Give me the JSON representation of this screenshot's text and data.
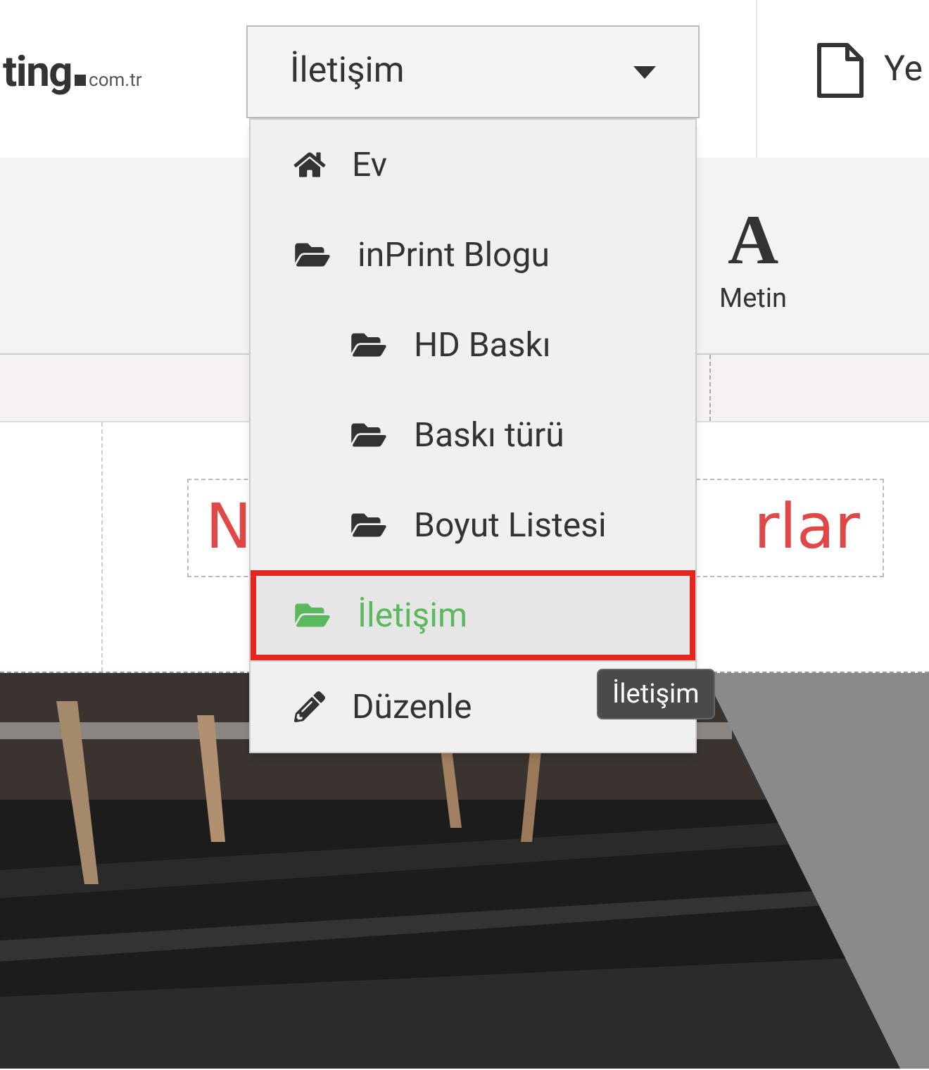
{
  "logo": {
    "name": "ting",
    "suffix": "com.tr"
  },
  "page_select": {
    "value": "İletişim",
    "expanded": true
  },
  "new_page": {
    "label": "Ye"
  },
  "toolbar": [
    {
      "label": "Metin",
      "glyph": "A"
    }
  ],
  "heading": {
    "left": "N",
    "right": "rlar"
  },
  "menu": [
    {
      "label": "Ev",
      "kind": "home",
      "selected": false
    },
    {
      "label": "inPrint Blogu",
      "kind": "folder",
      "selected": false,
      "children": [
        {
          "label": "HD Baskı",
          "kind": "folder",
          "selected": false
        },
        {
          "label": "Baskı türü",
          "kind": "folder",
          "selected": false
        },
        {
          "label": "Boyut Listesi",
          "kind": "folder",
          "selected": false
        }
      ]
    },
    {
      "label": "İletişim",
      "kind": "folder",
      "selected": true
    },
    {
      "label": "Düzenle",
      "kind": "edit",
      "selected": false
    }
  ],
  "tooltip": "İletişim"
}
